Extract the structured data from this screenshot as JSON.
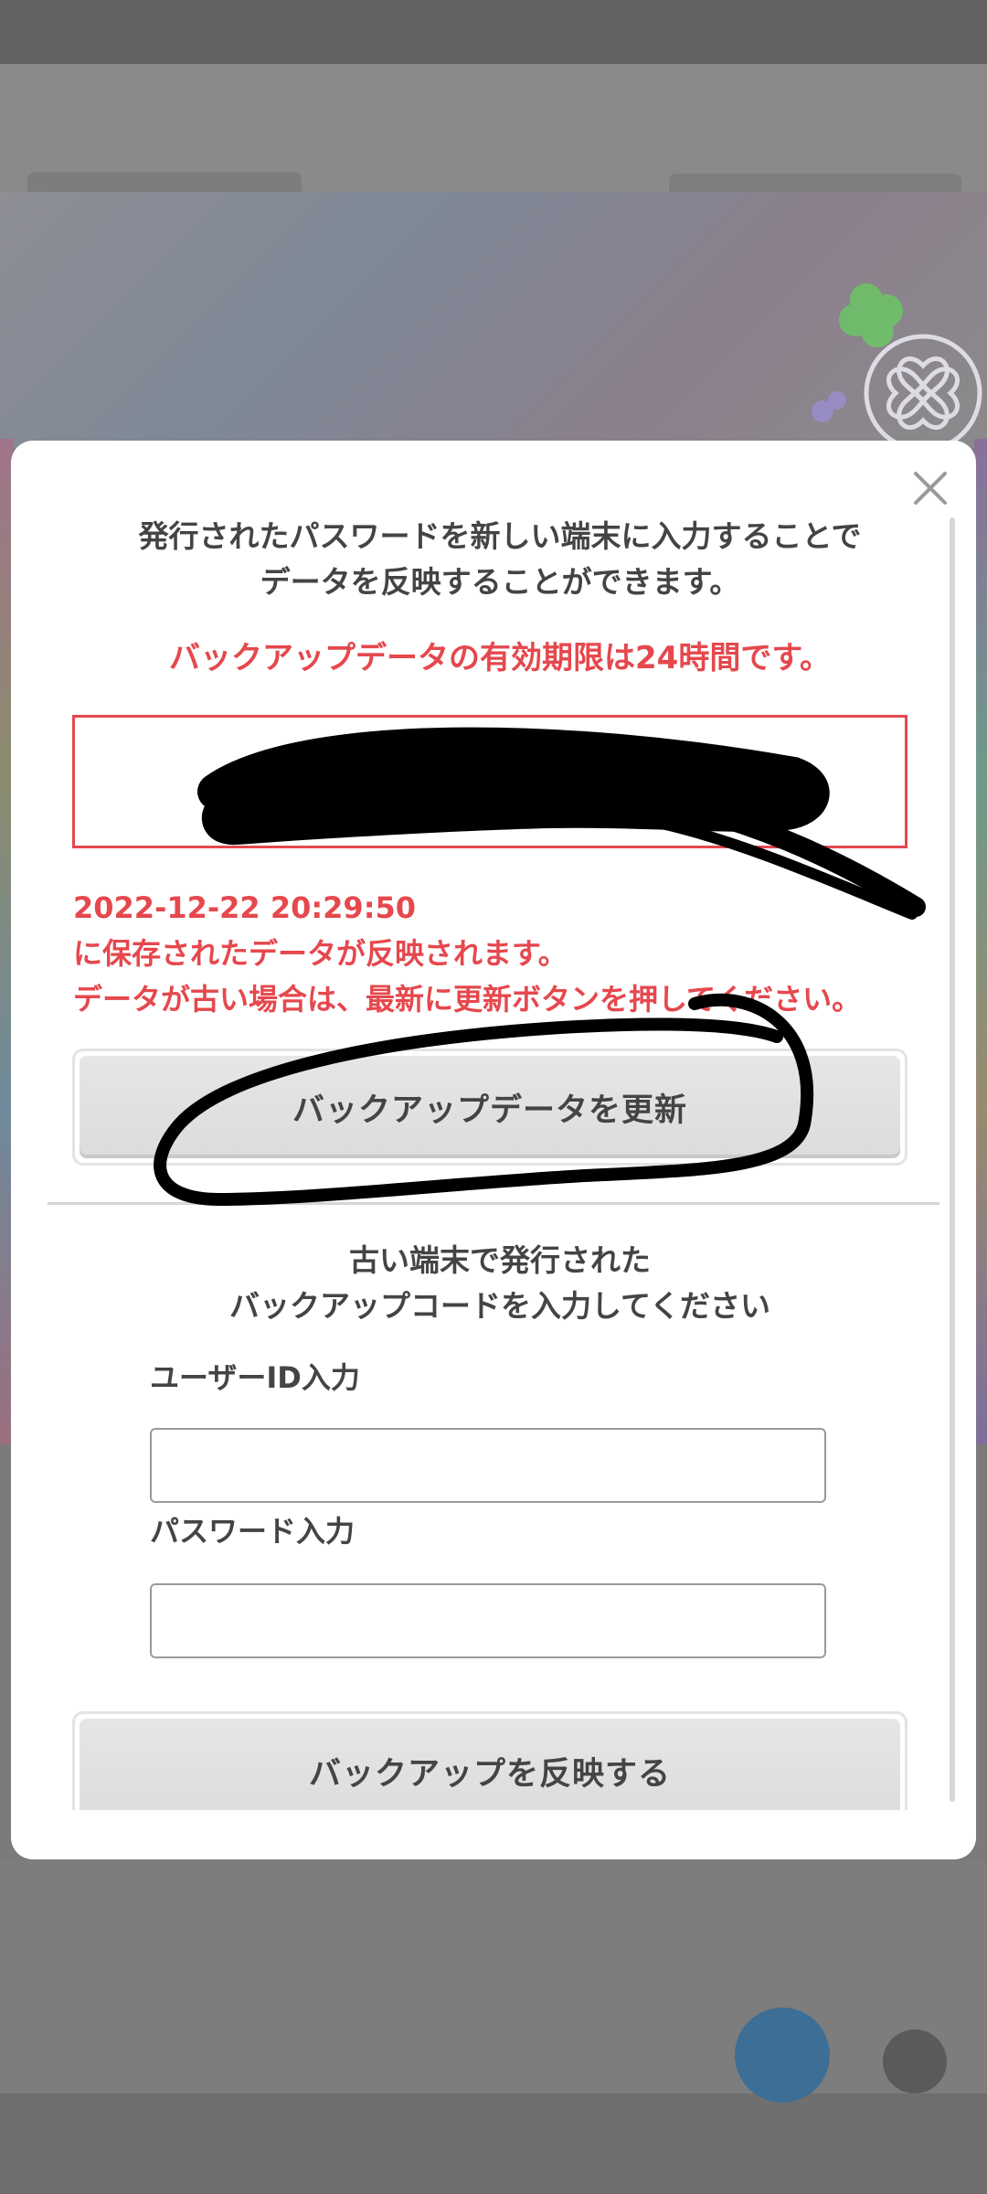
{
  "modal": {
    "intro_line1": "発行されたパスワードを新しい端末に入力することで",
    "intro_line2": "データを反映することができます。",
    "expiry_warning": "バックアップデータの有効期限は24時間です。",
    "saved_datetime": "2022-12-22 20:29:50",
    "saved_line2": "に保存されたデータが反映されます。",
    "saved_line3": "データが古い場合は、最新に更新ボタンを押してください。",
    "update_button_label": "バックアップデータを更新",
    "instructions_line1": "古い端末で発行された",
    "instructions_line2": "バックアップコードを入力してください",
    "user_id_label": "ユーザーID入力",
    "user_id_value": "",
    "password_label": "パスワード入力",
    "password_value": "",
    "restore_button_label": "バックアップを反映する",
    "close_icon": "close-icon"
  },
  "colors": {
    "warning_red": "#e5484d",
    "text_dark": "#444444",
    "button_gray": "#dcdcdc",
    "overlay_gray": "#7b7b7b"
  }
}
